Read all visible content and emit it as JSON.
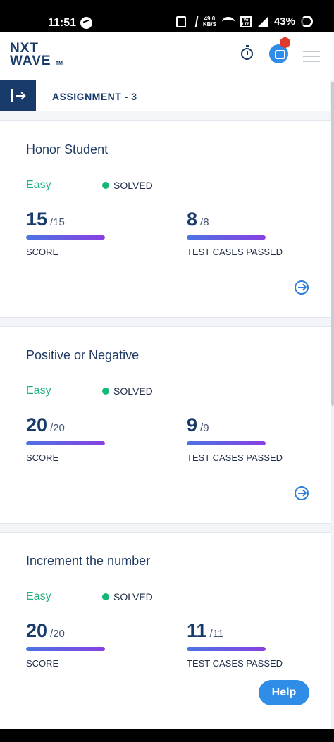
{
  "status_bar": {
    "time": "11:51",
    "net_speed_top": "49.0",
    "net_speed_bottom": "KB/S",
    "volte_top": "Vo",
    "volte_bottom": "LTE",
    "battery": "43%"
  },
  "header": {
    "logo_line1": "NXT",
    "logo_line2": "WAVE",
    "logo_tm": "TM"
  },
  "assignment": {
    "title": "ASSIGNMENT - 3"
  },
  "problems": [
    {
      "title": "Honor Student",
      "difficulty": "Easy",
      "status": "SOLVED",
      "score": "15",
      "score_total": "/15",
      "score_label": "SCORE",
      "score_progress": 1.0,
      "tests": "8",
      "tests_total": "/8",
      "tests_label": "TEST CASES PASSED",
      "tests_progress": 1.0
    },
    {
      "title": "Positive or Negative",
      "difficulty": "Easy",
      "status": "SOLVED",
      "score": "20",
      "score_total": "/20",
      "score_label": "SCORE",
      "score_progress": 1.0,
      "tests": "9",
      "tests_total": "/9",
      "tests_label": "TEST CASES PASSED",
      "tests_progress": 1.0
    },
    {
      "title": "Increment the number",
      "difficulty": "Easy",
      "status": "SOLVED",
      "score": "20",
      "score_total": "/20",
      "score_label": "SCORE",
      "score_progress": 1.0,
      "tests": "11",
      "tests_total": "/11",
      "tests_label": "TEST CASES PASSED",
      "tests_progress": 1.0
    }
  ],
  "help_label": "Help",
  "colors": {
    "brand": "#183b6b",
    "easy": "#20b27a",
    "solved_dot": "#13b874",
    "accent_blue": "#2f8de7",
    "notification": "#e0392d"
  }
}
